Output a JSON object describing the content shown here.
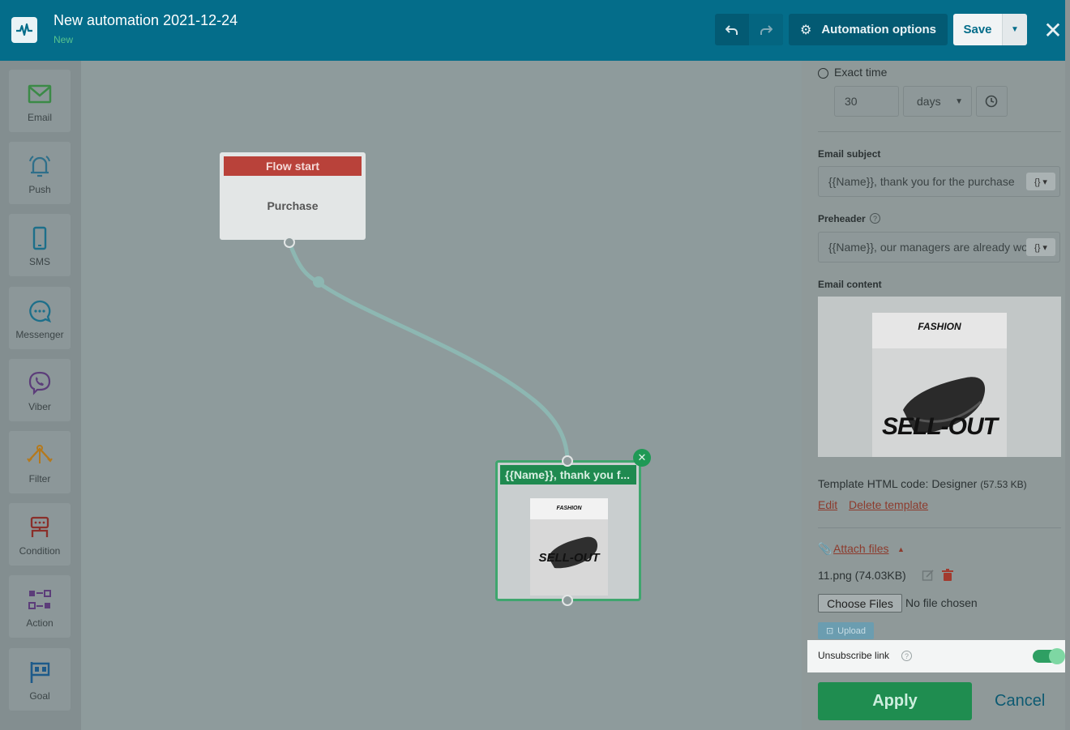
{
  "header": {
    "title": "New automation 2021-12-24",
    "status": "New",
    "options_label": "Automation options",
    "save_label": "Save"
  },
  "tools": [
    {
      "label": "Email",
      "icon": "envelope-icon",
      "color": "#3b8a47"
    },
    {
      "label": "Push",
      "icon": "bell-icon",
      "color": "#2f6f8a"
    },
    {
      "label": "SMS",
      "icon": "phone-icon",
      "color": "#1d6f8a"
    },
    {
      "label": "Messenger",
      "icon": "chat-icon",
      "color": "#1d6f8a"
    },
    {
      "label": "Viber",
      "icon": "viber-icon",
      "color": "#5c3d7a"
    },
    {
      "label": "Filter",
      "icon": "filter-icon",
      "color": "#b5791c"
    },
    {
      "label": "Condition",
      "icon": "condition-icon",
      "color": "#8a2f2a"
    },
    {
      "label": "Action",
      "icon": "action-icon",
      "color": "#5c3d7a"
    },
    {
      "label": "Goal",
      "icon": "flag-icon",
      "color": "#1d5a8a"
    }
  ],
  "canvas": {
    "flow_start_title": "Flow start",
    "flow_start_event": "Purchase",
    "email_node_title": "{{Name}}, thank you f..."
  },
  "panel": {
    "exact_time_label": "Exact time",
    "time_value": "30",
    "time_unit": "days",
    "subject_label": "Email subject",
    "subject_value": "{{Name}}, thank you for the purchase",
    "preheader_label": "Preheader",
    "preheader_value": "{{Name}}, our managers are already working",
    "content_label": "Email content",
    "preview_brand": "FASHION",
    "preview_headline": "SELL-OUT",
    "template_prefix": "Template HTML code: Designer",
    "template_size": "(57.53 KB)",
    "edit_label": "Edit",
    "delete_label": "Delete template",
    "attach_label": "Attach files",
    "attached_file": "11.png (74.03KB)",
    "choose_files_label": "Choose Files",
    "no_file_label": "No file chosen",
    "upload_label": "Upload",
    "unsubscribe_label": "Unsubscribe link",
    "unsubscribe_on": true,
    "apply_label": "Apply",
    "cancel_label": "Cancel"
  }
}
